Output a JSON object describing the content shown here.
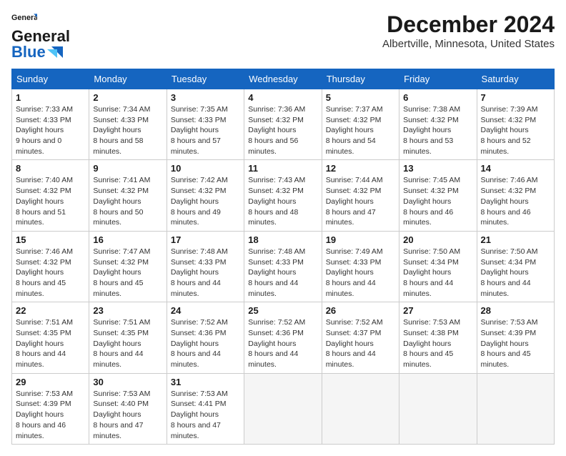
{
  "header": {
    "logo_line1": "General",
    "logo_line2": "Blue",
    "month": "December 2024",
    "location": "Albertville, Minnesota, United States"
  },
  "weekdays": [
    "Sunday",
    "Monday",
    "Tuesday",
    "Wednesday",
    "Thursday",
    "Friday",
    "Saturday"
  ],
  "weeks": [
    [
      {
        "day": "1",
        "sunrise": "7:33 AM",
        "sunset": "4:33 PM",
        "daylight": "9 hours and 0 minutes."
      },
      {
        "day": "2",
        "sunrise": "7:34 AM",
        "sunset": "4:33 PM",
        "daylight": "8 hours and 58 minutes."
      },
      {
        "day": "3",
        "sunrise": "7:35 AM",
        "sunset": "4:33 PM",
        "daylight": "8 hours and 57 minutes."
      },
      {
        "day": "4",
        "sunrise": "7:36 AM",
        "sunset": "4:32 PM",
        "daylight": "8 hours and 56 minutes."
      },
      {
        "day": "5",
        "sunrise": "7:37 AM",
        "sunset": "4:32 PM",
        "daylight": "8 hours and 54 minutes."
      },
      {
        "day": "6",
        "sunrise": "7:38 AM",
        "sunset": "4:32 PM",
        "daylight": "8 hours and 53 minutes."
      },
      {
        "day": "7",
        "sunrise": "7:39 AM",
        "sunset": "4:32 PM",
        "daylight": "8 hours and 52 minutes."
      }
    ],
    [
      {
        "day": "8",
        "sunrise": "7:40 AM",
        "sunset": "4:32 PM",
        "daylight": "8 hours and 51 minutes."
      },
      {
        "day": "9",
        "sunrise": "7:41 AM",
        "sunset": "4:32 PM",
        "daylight": "8 hours and 50 minutes."
      },
      {
        "day": "10",
        "sunrise": "7:42 AM",
        "sunset": "4:32 PM",
        "daylight": "8 hours and 49 minutes."
      },
      {
        "day": "11",
        "sunrise": "7:43 AM",
        "sunset": "4:32 PM",
        "daylight": "8 hours and 48 minutes."
      },
      {
        "day": "12",
        "sunrise": "7:44 AM",
        "sunset": "4:32 PM",
        "daylight": "8 hours and 47 minutes."
      },
      {
        "day": "13",
        "sunrise": "7:45 AM",
        "sunset": "4:32 PM",
        "daylight": "8 hours and 46 minutes."
      },
      {
        "day": "14",
        "sunrise": "7:46 AM",
        "sunset": "4:32 PM",
        "daylight": "8 hours and 46 minutes."
      }
    ],
    [
      {
        "day": "15",
        "sunrise": "7:46 AM",
        "sunset": "4:32 PM",
        "daylight": "8 hours and 45 minutes."
      },
      {
        "day": "16",
        "sunrise": "7:47 AM",
        "sunset": "4:32 PM",
        "daylight": "8 hours and 45 minutes."
      },
      {
        "day": "17",
        "sunrise": "7:48 AM",
        "sunset": "4:33 PM",
        "daylight": "8 hours and 44 minutes."
      },
      {
        "day": "18",
        "sunrise": "7:48 AM",
        "sunset": "4:33 PM",
        "daylight": "8 hours and 44 minutes."
      },
      {
        "day": "19",
        "sunrise": "7:49 AM",
        "sunset": "4:33 PM",
        "daylight": "8 hours and 44 minutes."
      },
      {
        "day": "20",
        "sunrise": "7:50 AM",
        "sunset": "4:34 PM",
        "daylight": "8 hours and 44 minutes."
      },
      {
        "day": "21",
        "sunrise": "7:50 AM",
        "sunset": "4:34 PM",
        "daylight": "8 hours and 44 minutes."
      }
    ],
    [
      {
        "day": "22",
        "sunrise": "7:51 AM",
        "sunset": "4:35 PM",
        "daylight": "8 hours and 44 minutes."
      },
      {
        "day": "23",
        "sunrise": "7:51 AM",
        "sunset": "4:35 PM",
        "daylight": "8 hours and 44 minutes."
      },
      {
        "day": "24",
        "sunrise": "7:52 AM",
        "sunset": "4:36 PM",
        "daylight": "8 hours and 44 minutes."
      },
      {
        "day": "25",
        "sunrise": "7:52 AM",
        "sunset": "4:36 PM",
        "daylight": "8 hours and 44 minutes."
      },
      {
        "day": "26",
        "sunrise": "7:52 AM",
        "sunset": "4:37 PM",
        "daylight": "8 hours and 44 minutes."
      },
      {
        "day": "27",
        "sunrise": "7:53 AM",
        "sunset": "4:38 PM",
        "daylight": "8 hours and 45 minutes."
      },
      {
        "day": "28",
        "sunrise": "7:53 AM",
        "sunset": "4:39 PM",
        "daylight": "8 hours and 45 minutes."
      }
    ],
    [
      {
        "day": "29",
        "sunrise": "7:53 AM",
        "sunset": "4:39 PM",
        "daylight": "8 hours and 46 minutes."
      },
      {
        "day": "30",
        "sunrise": "7:53 AM",
        "sunset": "4:40 PM",
        "daylight": "8 hours and 47 minutes."
      },
      {
        "day": "31",
        "sunrise": "7:53 AM",
        "sunset": "4:41 PM",
        "daylight": "8 hours and 47 minutes."
      },
      null,
      null,
      null,
      null
    ]
  ],
  "labels": {
    "sunrise": "Sunrise:",
    "sunset": "Sunset:",
    "daylight": "Daylight hours"
  }
}
